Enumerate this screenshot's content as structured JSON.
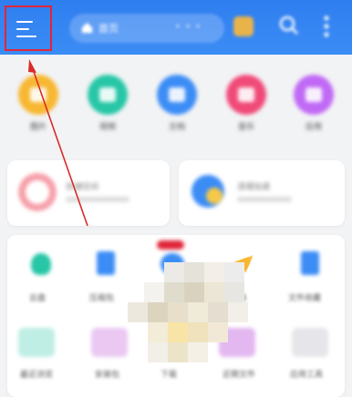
{
  "topbar": {
    "menu_button_label": "",
    "search_pill": {
      "home_label": "首页",
      "extra": "• • •"
    },
    "icons": [
      "menu-icon",
      "home-icon",
      "card-icon",
      "search-icon",
      "more-vertical-icon"
    ]
  },
  "quick_apps": [
    {
      "label": "图片",
      "color": "#f7b731",
      "icon": "image-icon"
    },
    {
      "label": "视频",
      "color": "#26c6a6",
      "icon": "video-icon"
    },
    {
      "label": "文档",
      "color": "#3b8cf5",
      "icon": "document-icon"
    },
    {
      "label": "音乐",
      "color": "#f04a78",
      "icon": "music-icon"
    },
    {
      "label": "应用",
      "color": "#c069f5",
      "icon": "app-icon"
    }
  ],
  "cards": [
    {
      "title": "存储空间",
      "icon": "storage-icon",
      "color": "#f06070"
    },
    {
      "title": "清理加速",
      "icon": "clean-icon",
      "color": "#3b8cf5"
    }
  ],
  "tools": [
    {
      "label": "云盘",
      "color": "#26c6a6",
      "icon": "cloud-icon"
    },
    {
      "label": "压缩包",
      "color": "#3b8cf5",
      "icon": "zip-icon"
    },
    {
      "label": "",
      "color": "#3b8cf5",
      "icon": "new-badge-icon",
      "badge": "NEW"
    },
    {
      "label": "传输",
      "color": "#f7b731",
      "icon": "send-icon"
    },
    {
      "label": "文件收藏",
      "color": "#3b8cf5",
      "icon": "favorite-file-icon"
    }
  ],
  "bottom_row": [
    {
      "label": "最近浏览"
    },
    {
      "label": "安装包"
    },
    {
      "label": "下载"
    },
    {
      "label": "近期文件"
    },
    {
      "label": "应用工具"
    }
  ],
  "colors": {
    "accent": "#2f7ef0",
    "highlight": "#e0263a",
    "annotation_arrow": "#d92b2b"
  }
}
